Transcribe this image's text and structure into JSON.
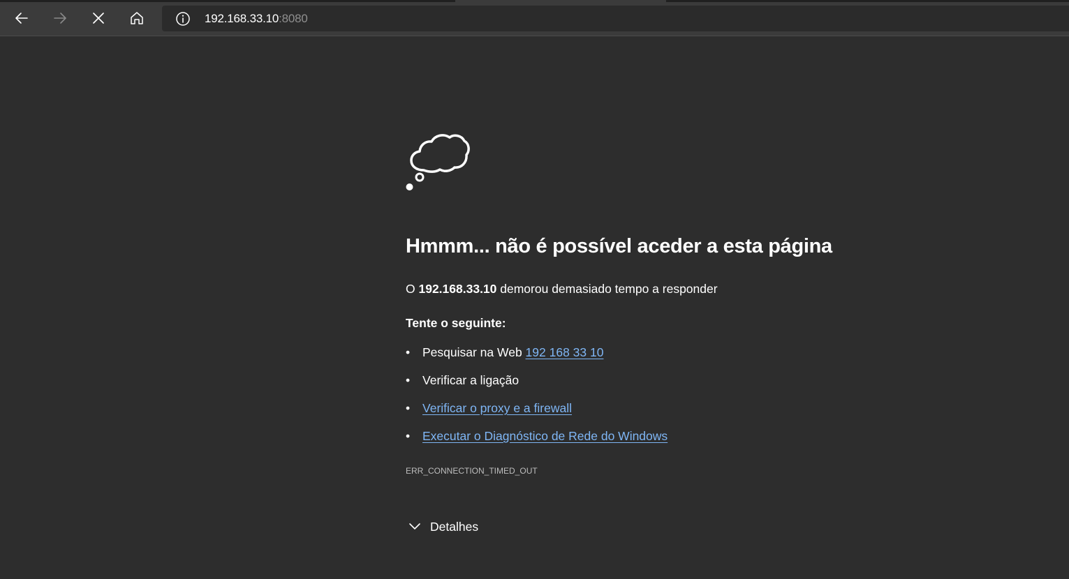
{
  "browser": {
    "address": {
      "host": "192.168.33.10",
      "port": ":8080"
    },
    "icons": {
      "back": "back-arrow-icon",
      "forward": "forward-arrow-icon",
      "stop": "close-icon",
      "home": "home-icon",
      "info": "info-icon"
    }
  },
  "error_page": {
    "icon": "thought-cloud-icon",
    "headline": "Hmmm... não é possível aceder a esta página",
    "message": {
      "prefix": "O ",
      "host": "192.168.33.10",
      "suffix": " demorou demasiado tempo a responder"
    },
    "try_heading": "Tente o seguinte:",
    "suggestions": [
      {
        "text": "Pesquisar na Web ",
        "link": "192 168 33 10"
      },
      {
        "text": "Verificar a ligação",
        "link": ""
      },
      {
        "text": "",
        "link": "Verificar o proxy e a firewall"
      },
      {
        "text": "",
        "link": "Executar o Diagnóstico de Rede do Windows"
      }
    ],
    "bullet": "•",
    "error_code": "ERR_CONNECTION_TIMED_OUT",
    "details_label": "Detalhes"
  },
  "colors": {
    "page_background": "#2d2d2d",
    "toolbar_background": "#3b3b3b",
    "link": "#7fb6f5",
    "text": "#ffffff",
    "muted": "#8f8f8f"
  }
}
